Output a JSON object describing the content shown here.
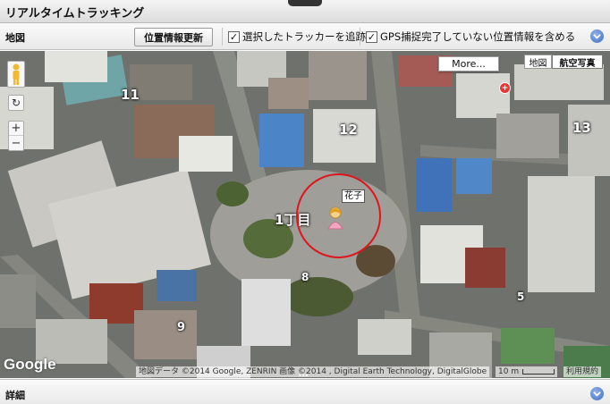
{
  "window": {
    "title": "リアルタイムトラッキング"
  },
  "toolbar": {
    "panel_label": "地図",
    "update_button": "位置情報更新",
    "track_checkbox": {
      "label": "選択したトラッカーを追跡",
      "checked": true,
      "mark": "✓"
    },
    "gps_checkbox": {
      "label": "GPS捕捉完了していない位置情報を含める",
      "checked": true,
      "mark": "✓"
    },
    "collapse_icon": "chevron-down-icon"
  },
  "map": {
    "more_button": "More...",
    "type_map": "地図",
    "type_satellite": "航空写真",
    "block_labels": {
      "b11": "11",
      "b12": "12",
      "b13": "13",
      "b1chome": "1丁目",
      "b8": "8",
      "b9": "9",
      "b5": "5"
    },
    "tracker": {
      "name": "花子",
      "circle_color": "#e0141c"
    },
    "poi_label": "+",
    "google_logo": "Google",
    "attribution": "地図データ ©2014 Google, ZENRIN 画像 ©2014 , Digital Earth Technology, DigitalGlobe",
    "scale": "10 m",
    "terms": "利用規約",
    "zoom_in": "+",
    "zoom_out": "−",
    "rotate": "↻"
  },
  "detail": {
    "label": "詳細",
    "collapse_icon": "chevron-down-icon"
  },
  "colors": {
    "accent": "#3d6fc4",
    "tracker_circle": "#e0141c"
  }
}
